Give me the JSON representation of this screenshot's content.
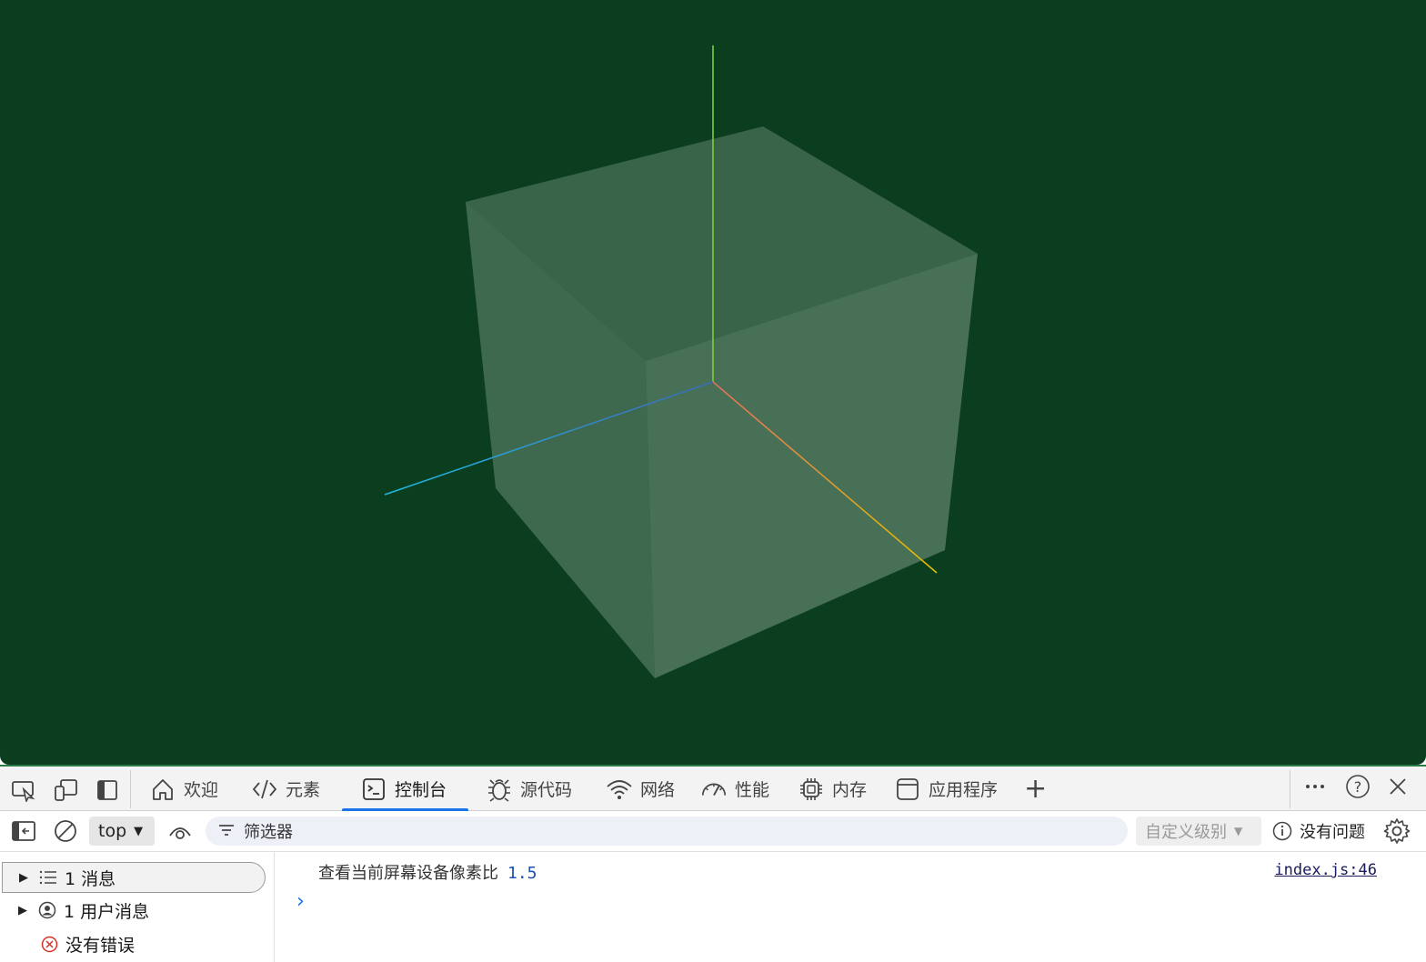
{
  "scene": {
    "background": "#0b3d1f",
    "cube_fill": "#7a9a84",
    "axis_colors": {
      "y": "#7ccf3a",
      "x_start": "#e07060",
      "x_end": "#e0c000",
      "z_start": "#3a6ab8",
      "z_end": "#20b8e0"
    }
  },
  "devtools": {
    "panel_icons": [
      "inspect-icon",
      "device-emulation-icon",
      "dock-icon"
    ],
    "tabs": [
      {
        "label": "欢迎",
        "icon": "home-icon"
      },
      {
        "label": "元素",
        "icon": "code-icon"
      },
      {
        "label": "控制台",
        "icon": "console-icon",
        "active": true
      },
      {
        "label": "源代码",
        "icon": "bug-icon"
      },
      {
        "label": "网络",
        "icon": "wifi-icon"
      },
      {
        "label": "性能",
        "icon": "gauge-icon"
      },
      {
        "label": "内存",
        "icon": "chip-icon"
      },
      {
        "label": "应用程序",
        "icon": "window-icon"
      }
    ],
    "add_tab": "+",
    "toolbar": {
      "context": "top",
      "filter_placeholder": "筛选器",
      "levels": "自定义级别",
      "issues": "没有问题"
    },
    "sidebar": {
      "items": [
        {
          "label": "1 消息",
          "icon": "list-icon"
        },
        {
          "label": "1 用户消息",
          "icon": "user-icon"
        },
        {
          "label": "没有错误",
          "icon": "error-icon"
        }
      ]
    },
    "console": {
      "message_text": "查看当前屏幕设备像素比",
      "message_value": "1.5",
      "source": "index.js:46",
      "prompt": "›"
    }
  }
}
